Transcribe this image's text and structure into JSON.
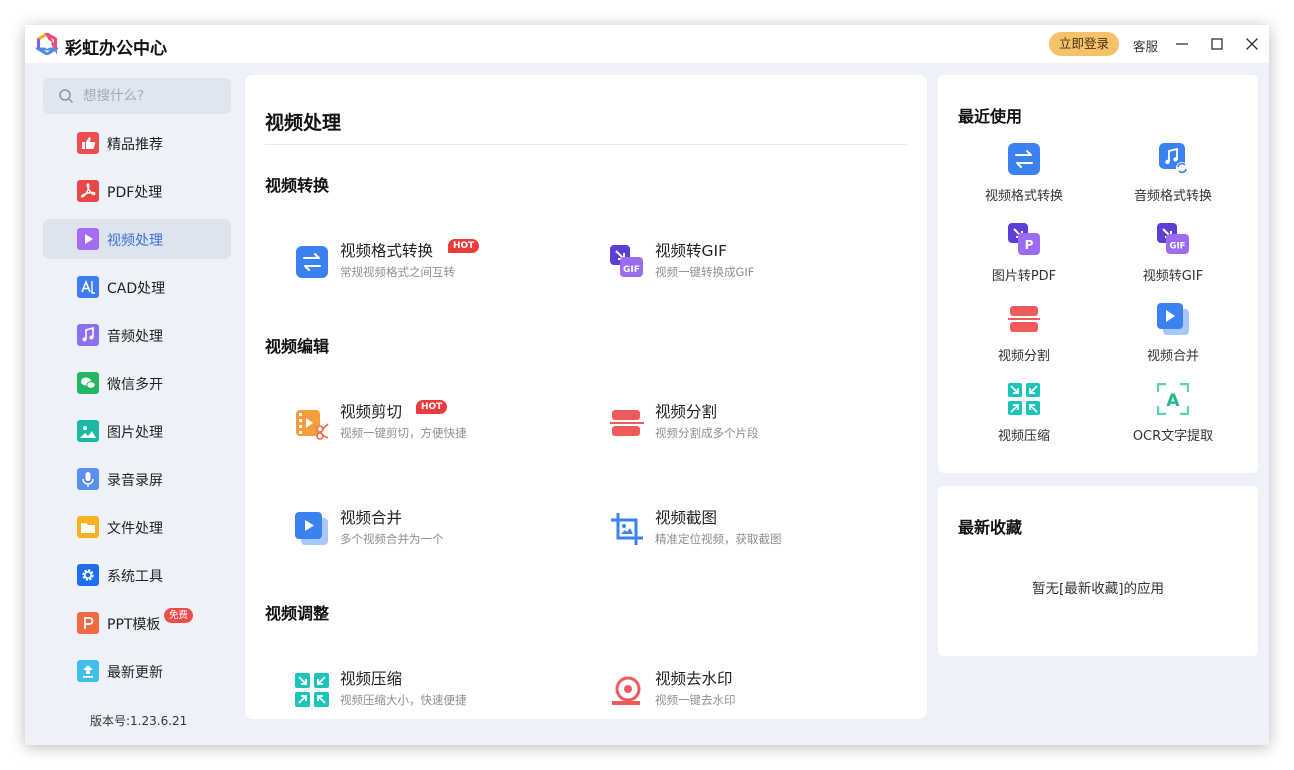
{
  "app": {
    "title": "彩虹办公中心",
    "login_label": "立即登录",
    "service_label": "客服"
  },
  "search": {
    "placeholder": "想搜什么?"
  },
  "sidebar": {
    "items": [
      {
        "label": "精品推荐",
        "icon": "thumbs-up-icon"
      },
      {
        "label": "PDF处理",
        "icon": "pdf-icon"
      },
      {
        "label": "视频处理",
        "icon": "video-play-icon",
        "active": true
      },
      {
        "label": "CAD处理",
        "icon": "cad-icon"
      },
      {
        "label": "音频处理",
        "icon": "music-icon"
      },
      {
        "label": "微信多开",
        "icon": "wechat-icon"
      },
      {
        "label": "图片处理",
        "icon": "image-icon"
      },
      {
        "label": "录音录屏",
        "icon": "microphone-icon"
      },
      {
        "label": "文件处理",
        "icon": "folder-icon"
      },
      {
        "label": "系统工具",
        "icon": "gear-icon"
      },
      {
        "label": "PPT模板",
        "icon": "ppt-icon",
        "badge": "免费"
      },
      {
        "label": "最新更新",
        "icon": "upload-icon"
      }
    ],
    "version": "版本号:1.23.6.21"
  },
  "main": {
    "title": "视频处理",
    "sections": [
      {
        "title": "视频转换",
        "tools": [
          {
            "name": "视频格式转换",
            "desc": "常规视频格式之间互转",
            "badge": "HOT",
            "icon": "swap-arrows-icon"
          },
          {
            "name": "视频转GIF",
            "desc": "视频一键转换成GIF",
            "icon": "gif-icon"
          }
        ]
      },
      {
        "title": "视频编辑",
        "tools": [
          {
            "name": "视频剪切",
            "desc": "视频一键剪切，方便快捷",
            "badge": "HOT",
            "icon": "video-cut-icon"
          },
          {
            "name": "视频分割",
            "desc": "视频分割成多个片段",
            "icon": "split-icon"
          },
          {
            "name": "视频合并",
            "desc": "多个视频合并为一个",
            "icon": "video-merge-icon"
          },
          {
            "name": "视频截图",
            "desc": "精准定位视频，获取截图",
            "icon": "crop-icon"
          }
        ]
      },
      {
        "title": "视频调整",
        "tools": [
          {
            "name": "视频压缩",
            "desc": "视频压缩大小，快速便捷",
            "icon": "compress-icon"
          },
          {
            "name": "视频去水印",
            "desc": "视频一键去水印",
            "icon": "watermark-icon"
          }
        ]
      }
    ]
  },
  "recent": {
    "title": "最近使用",
    "items": [
      {
        "label": "视频格式转换",
        "icon": "swap-arrows-icon"
      },
      {
        "label": "音频格式转换",
        "icon": "music-convert-icon"
      },
      {
        "label": "图片转PDF",
        "icon": "image-to-pdf-icon"
      },
      {
        "label": "视频转GIF",
        "icon": "gif-icon"
      },
      {
        "label": "视频分割",
        "icon": "split-icon"
      },
      {
        "label": "视频合并",
        "icon": "video-merge-icon"
      },
      {
        "label": "视频压缩",
        "icon": "compress-icon"
      },
      {
        "label": "OCR文字提取",
        "icon": "ocr-icon"
      }
    ]
  },
  "favorites": {
    "title": "最新收藏",
    "empty_text": "暂无[最新收藏]的应用"
  },
  "colors": {
    "accent": "#3b6fd6",
    "login": "#f5c26b",
    "hot": "#ee3b3b",
    "window_bg": "#eef2f8"
  }
}
